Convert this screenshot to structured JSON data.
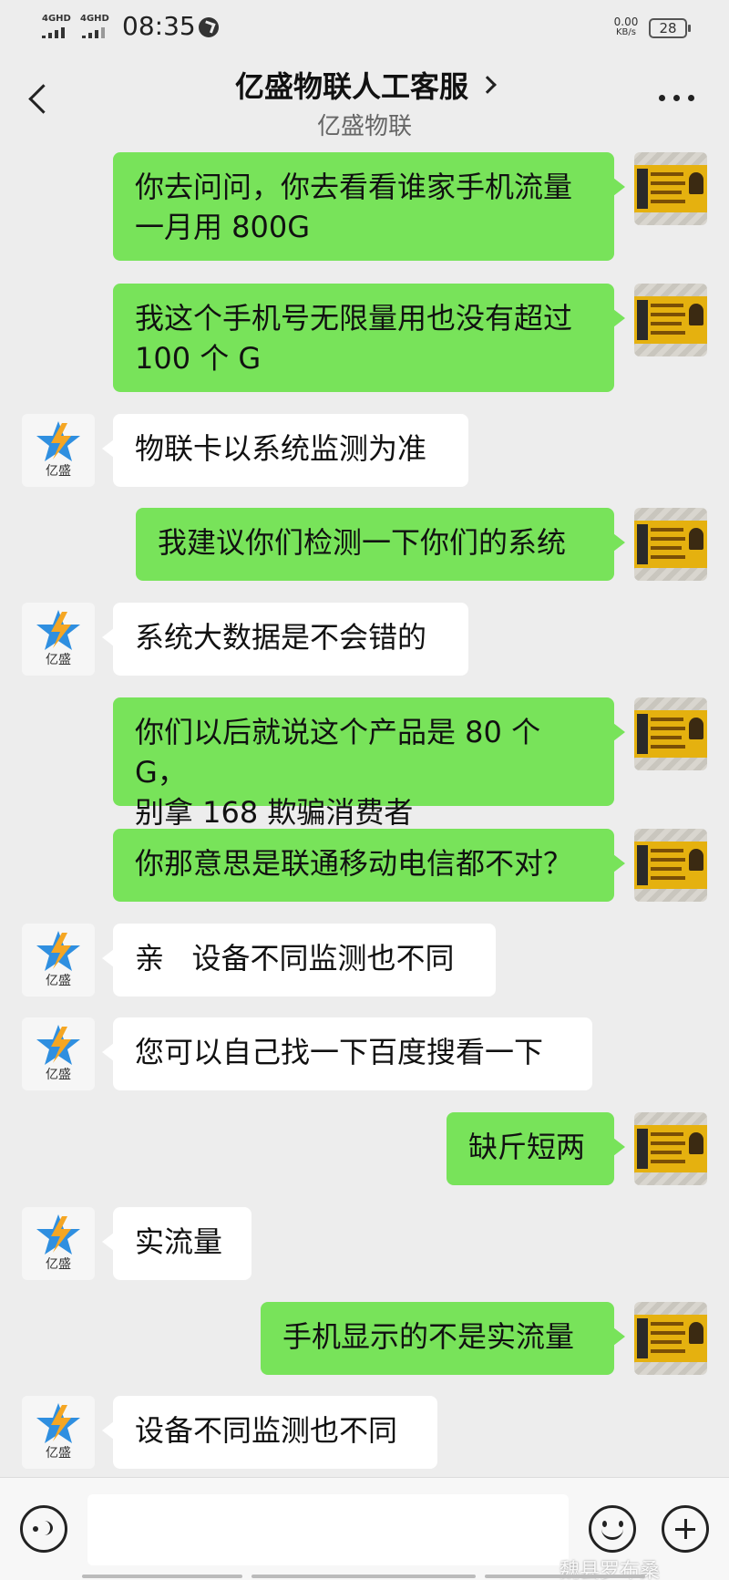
{
  "status_bar": {
    "signal_1": "4GHD",
    "signal_2": "4GHD",
    "time": "08:35",
    "net_speed_value": "0.00",
    "net_speed_unit": "KB/s",
    "battery": "28"
  },
  "header": {
    "title": "亿盛物联人工客服",
    "subtitle": "亿盛物联"
  },
  "contact": {
    "avatar_label": "亿盛"
  },
  "messages": [
    {
      "from": "me",
      "text": "你去问问，你去看看谁家手机流量\n一月用 800G"
    },
    {
      "from": "me",
      "text": "我这个手机号无限量用也没有超过\n100 个 G"
    },
    {
      "from": "them",
      "text": "物联卡以系统监测为准"
    },
    {
      "from": "me",
      "text": "我建议你们检测一下你们的系统"
    },
    {
      "from": "them",
      "text": "系统大数据是不会错的"
    },
    {
      "from": "me",
      "text": "你们以后就说这个产品是 80 个 G，\n别拿 168 欺骗消费者"
    },
    {
      "from": "me",
      "text": "你那意思是联通移动电信都不对？"
    },
    {
      "from": "them",
      "text": "亲   设备不同监测也不同"
    },
    {
      "from": "them",
      "text": "您可以自己找一下百度搜看一下"
    },
    {
      "from": "me",
      "text": "缺斤短两"
    },
    {
      "from": "them",
      "text": "实流量"
    },
    {
      "from": "me",
      "text": "手机显示的不是实流量"
    },
    {
      "from": "them",
      "text": "设备不同监测也不同"
    }
  ],
  "input": {
    "placeholder": ""
  },
  "watermark": "魏县罗布桑"
}
